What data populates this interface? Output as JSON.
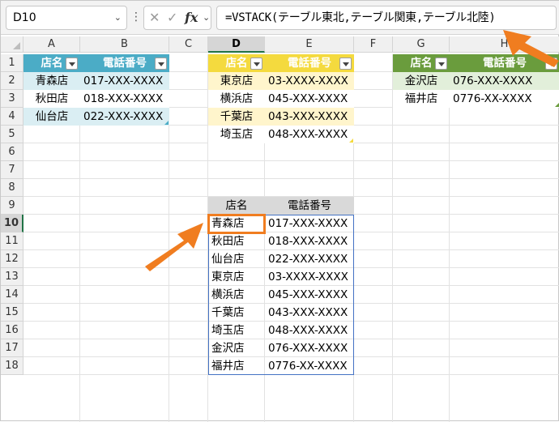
{
  "formula_bar": {
    "name_box": "D10",
    "formula": "=VSTACK(テーブル東北,テーブル関東,テーブル北陸)"
  },
  "columns": [
    "A",
    "B",
    "C",
    "D",
    "E",
    "F",
    "G",
    "H"
  ],
  "rows": [
    "1",
    "2",
    "3",
    "4",
    "5",
    "6",
    "7",
    "8",
    "9",
    "10",
    "11",
    "12",
    "13",
    "14",
    "15",
    "16",
    "17",
    "18"
  ],
  "selected": {
    "column": "D",
    "row": "10"
  },
  "tables": {
    "tohoku": {
      "headers": [
        "店名",
        "電話番号"
      ],
      "rows": [
        [
          "青森店",
          "017-XXX-XXXX"
        ],
        [
          "秋田店",
          "018-XXX-XXXX"
        ],
        [
          "仙台店",
          "022-XXX-XXXX"
        ]
      ],
      "header_color": "#4bacc6",
      "band_color": "#daeef3"
    },
    "kanto": {
      "headers": [
        "店名",
        "電話番号"
      ],
      "rows": [
        [
          "東京店",
          "03-XXXX-XXXX"
        ],
        [
          "横浜店",
          "045-XXX-XXXX"
        ],
        [
          "千葉店",
          "043-XXX-XXXX"
        ],
        [
          "埼玉店",
          "048-XXX-XXXX"
        ]
      ],
      "header_color": "#f4da3e",
      "band_color": "#fff5cc"
    },
    "hokuriku": {
      "headers": [
        "店名",
        "電話番号"
      ],
      "rows": [
        [
          "金沢店",
          "076-XXX-XXXX"
        ],
        [
          "福井店",
          "0776-XX-XXXX"
        ]
      ],
      "header_color": "#6a9c3d",
      "band_color": "#e2efda"
    }
  },
  "result": {
    "headers": [
      "店名",
      "電話番号"
    ],
    "rows": [
      [
        "青森店",
        "017-XXX-XXXX"
      ],
      [
        "秋田店",
        "018-XXX-XXXX"
      ],
      [
        "仙台店",
        "022-XXX-XXXX"
      ],
      [
        "東京店",
        "03-XXXX-XXXX"
      ],
      [
        "横浜店",
        "045-XXX-XXXX"
      ],
      [
        "千葉店",
        "043-XXX-XXXX"
      ],
      [
        "埼玉店",
        "048-XXX-XXXX"
      ],
      [
        "金沢店",
        "076-XXX-XXXX"
      ],
      [
        "福井店",
        "0776-XX-XXXX"
      ]
    ],
    "header_bg": "#d9d9d9"
  },
  "annotation_color": "#f07d20"
}
